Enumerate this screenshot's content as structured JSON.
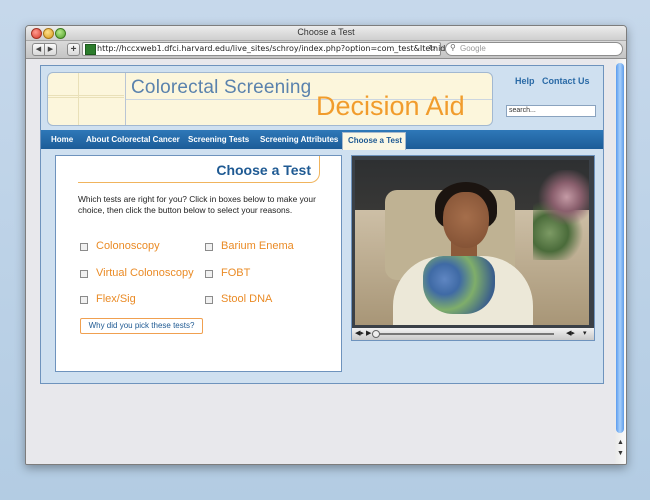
{
  "browser": {
    "window_title": "Choose a Test",
    "back_glyph": "◀",
    "forward_glyph": "▶",
    "plus_glyph": "+",
    "url": "http://hccxweb1.dfci.harvard.edu/live_sites/schroy/index.php?option=com_test&Itemid=11",
    "reload_glyph": "↻",
    "search_placeholder": "Google"
  },
  "site": {
    "title_line1": "Colorectal Screening",
    "title_line2": "Decision Aid",
    "links": {
      "help": "Help",
      "contact": "Contact Us"
    },
    "search_value": "search..."
  },
  "nav": {
    "items": [
      {
        "label": "Home"
      },
      {
        "label": "About Colorectal Cancer"
      },
      {
        "label": "Screening Tests"
      },
      {
        "label": "Screening Attributes"
      },
      {
        "label": "Choose a Test",
        "active": true
      }
    ]
  },
  "panel": {
    "title": "Choose a Test",
    "instructions": "Which tests are right for you? Click in boxes below to make your choice, then click the button below to select your reasons.",
    "options": [
      {
        "label": "Colonoscopy",
        "checked": false
      },
      {
        "label": "Barium Enema",
        "checked": false
      },
      {
        "label": "Virtual Colonoscopy",
        "checked": false
      },
      {
        "label": "FOBT",
        "checked": false
      },
      {
        "label": "Flex/Sig",
        "checked": false
      },
      {
        "label": "Stool DNA",
        "checked": false
      }
    ],
    "button_label": "Why did you pick these tests?"
  },
  "video": {
    "controls": {
      "volume_glyph": "◀▸",
      "play_glyph": "▶",
      "menu_glyph": "▾"
    }
  },
  "colors": {
    "brand_blue": "#1f5a93",
    "accent_orange": "#f19c2c",
    "nav_blue": "#2a6aa6"
  }
}
